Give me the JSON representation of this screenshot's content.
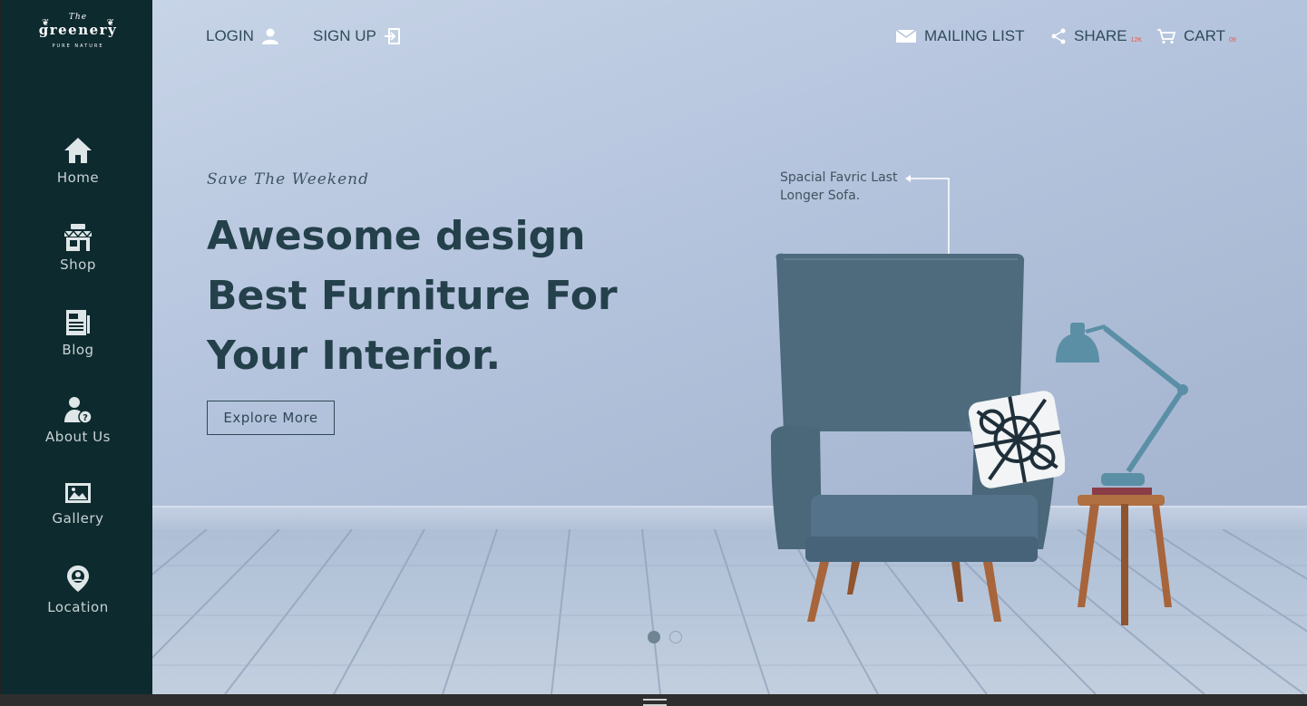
{
  "brand": {
    "the": "The",
    "name": "greenery",
    "tagline": "PURE NATURE"
  },
  "sidebar": {
    "items": [
      {
        "label": "Home",
        "icon": "home-icon"
      },
      {
        "label": "Shop",
        "icon": "shop-icon"
      },
      {
        "label": "Blog",
        "icon": "blog-icon"
      },
      {
        "label": "About Us",
        "icon": "about-us-icon"
      },
      {
        "label": "Gallery",
        "icon": "gallery-icon"
      },
      {
        "label": "Location",
        "icon": "location-icon"
      }
    ]
  },
  "topbar": {
    "login": "LOGIN",
    "signup": "SIGN UP",
    "mailing": "MAILING LIST",
    "share": "SHARE",
    "share_count": "12K",
    "cart": "CART",
    "cart_count": "09"
  },
  "hero": {
    "subtitle": "Save The Weekend",
    "headline": [
      "Awesome design",
      "Best Furniture For",
      "Your Interior."
    ],
    "cta": "Explore More",
    "callout": [
      "Spacial Favric Last",
      "Longer Sofa."
    ],
    "slides": 2,
    "active_slide": 1
  },
  "colors": {
    "sidebar": "#0d2a2f",
    "heading": "#24414b",
    "badge": "#e05a4a"
  }
}
